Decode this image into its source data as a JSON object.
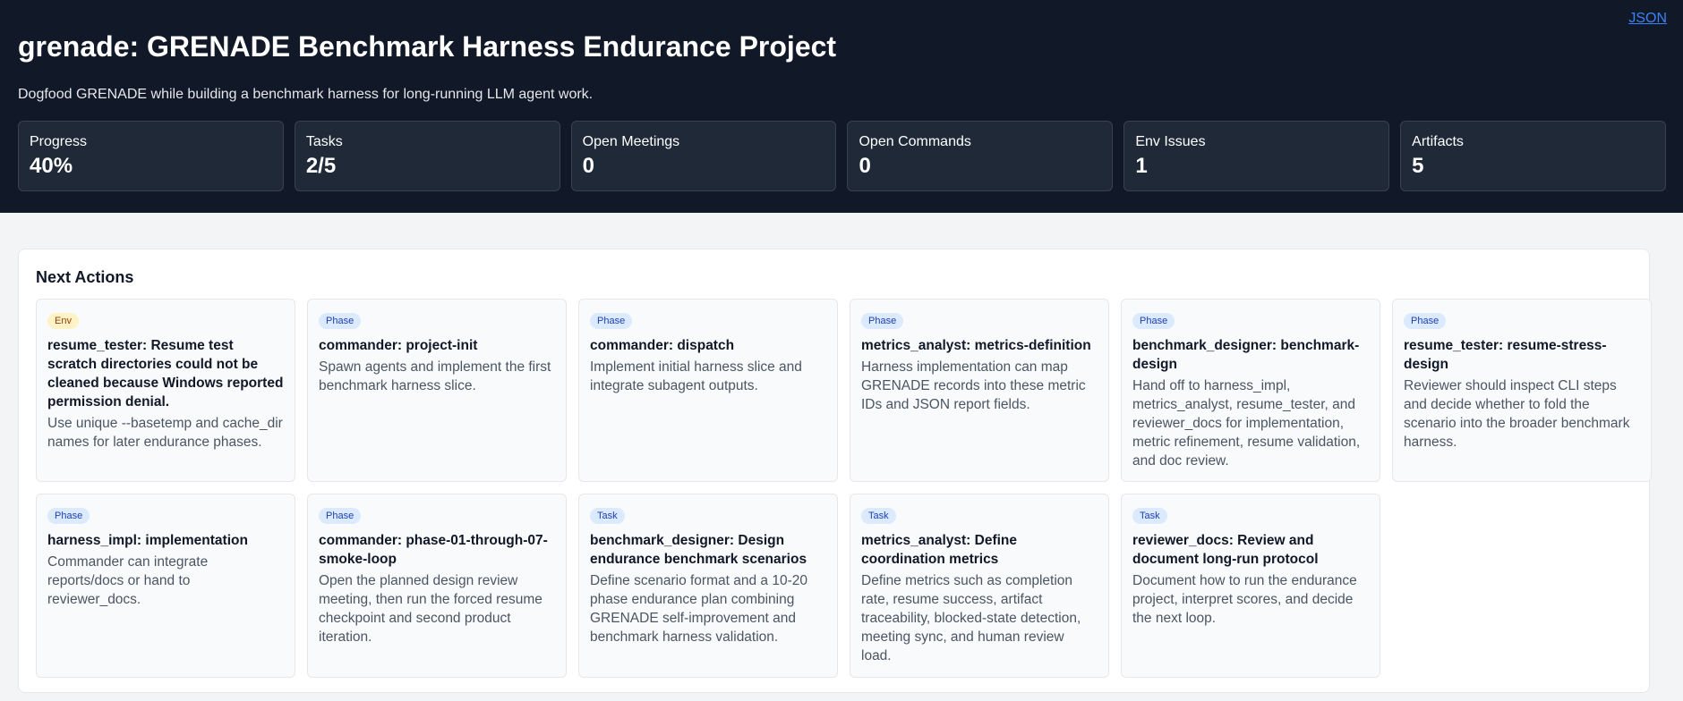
{
  "header": {
    "json_link": "JSON",
    "title": "grenade: GRENADE Benchmark Harness Endurance Project",
    "subtitle": "Dogfood GRENADE while building a benchmark harness for long-running LLM agent work."
  },
  "stats": [
    {
      "label": "Progress",
      "value": "40%"
    },
    {
      "label": "Tasks",
      "value": "2/5"
    },
    {
      "label": "Open Meetings",
      "value": "0"
    },
    {
      "label": "Open Commands",
      "value": "0"
    },
    {
      "label": "Env Issues",
      "value": "1"
    },
    {
      "label": "Artifacts",
      "value": "5"
    }
  ],
  "next_actions": {
    "title": "Next Actions",
    "cards": [
      {
        "badge": "Env",
        "title": "resume_tester: Resume test scratch directories could not be cleaned because Windows reported permission denial.",
        "desc": "Use unique --basetemp and cache_dir names for later endurance phases."
      },
      {
        "badge": "Phase",
        "title": "commander: project-init",
        "desc": "Spawn agents and implement the first benchmark harness slice."
      },
      {
        "badge": "Phase",
        "title": "commander: dispatch",
        "desc": "Implement initial harness slice and integrate subagent outputs."
      },
      {
        "badge": "Phase",
        "title": "metrics_analyst: metrics-definition",
        "desc": "Harness implementation can map GRENADE records into these metric IDs and JSON report fields."
      },
      {
        "badge": "Phase",
        "title": "benchmark_designer: benchmark-design",
        "desc": "Hand off to harness_impl, metrics_analyst, resume_tester, and reviewer_docs for implementation, metric refinement, resume validation, and doc review."
      },
      {
        "badge": "Phase",
        "title": "resume_tester: resume-stress-design",
        "desc": "Reviewer should inspect CLI steps and decide whether to fold the scenario into the broader benchmark harness."
      },
      {
        "badge": "Phase",
        "title": "harness_impl: implementation",
        "desc": "Commander can integrate reports/docs or hand to reviewer_docs."
      },
      {
        "badge": "Phase",
        "title": "commander: phase-01-through-07-smoke-loop",
        "desc": "Open the planned design review meeting, then run the forced resume checkpoint and second product iteration."
      },
      {
        "badge": "Task",
        "title": "benchmark_designer: Design endurance benchmark scenarios",
        "desc": "Define scenario format and a 10-20 phase endurance plan combining GRENADE self-improvement and benchmark harness validation."
      },
      {
        "badge": "Task",
        "title": "metrics_analyst: Define coordination metrics",
        "desc": "Define metrics such as completion rate, resume success, artifact traceability, blocked-state detection, meeting sync, and human review load."
      },
      {
        "badge": "Task",
        "title": "reviewer_docs: Review and document long-run protocol",
        "desc": "Document how to run the endurance project, interpret scores, and decide the next loop."
      }
    ]
  }
}
